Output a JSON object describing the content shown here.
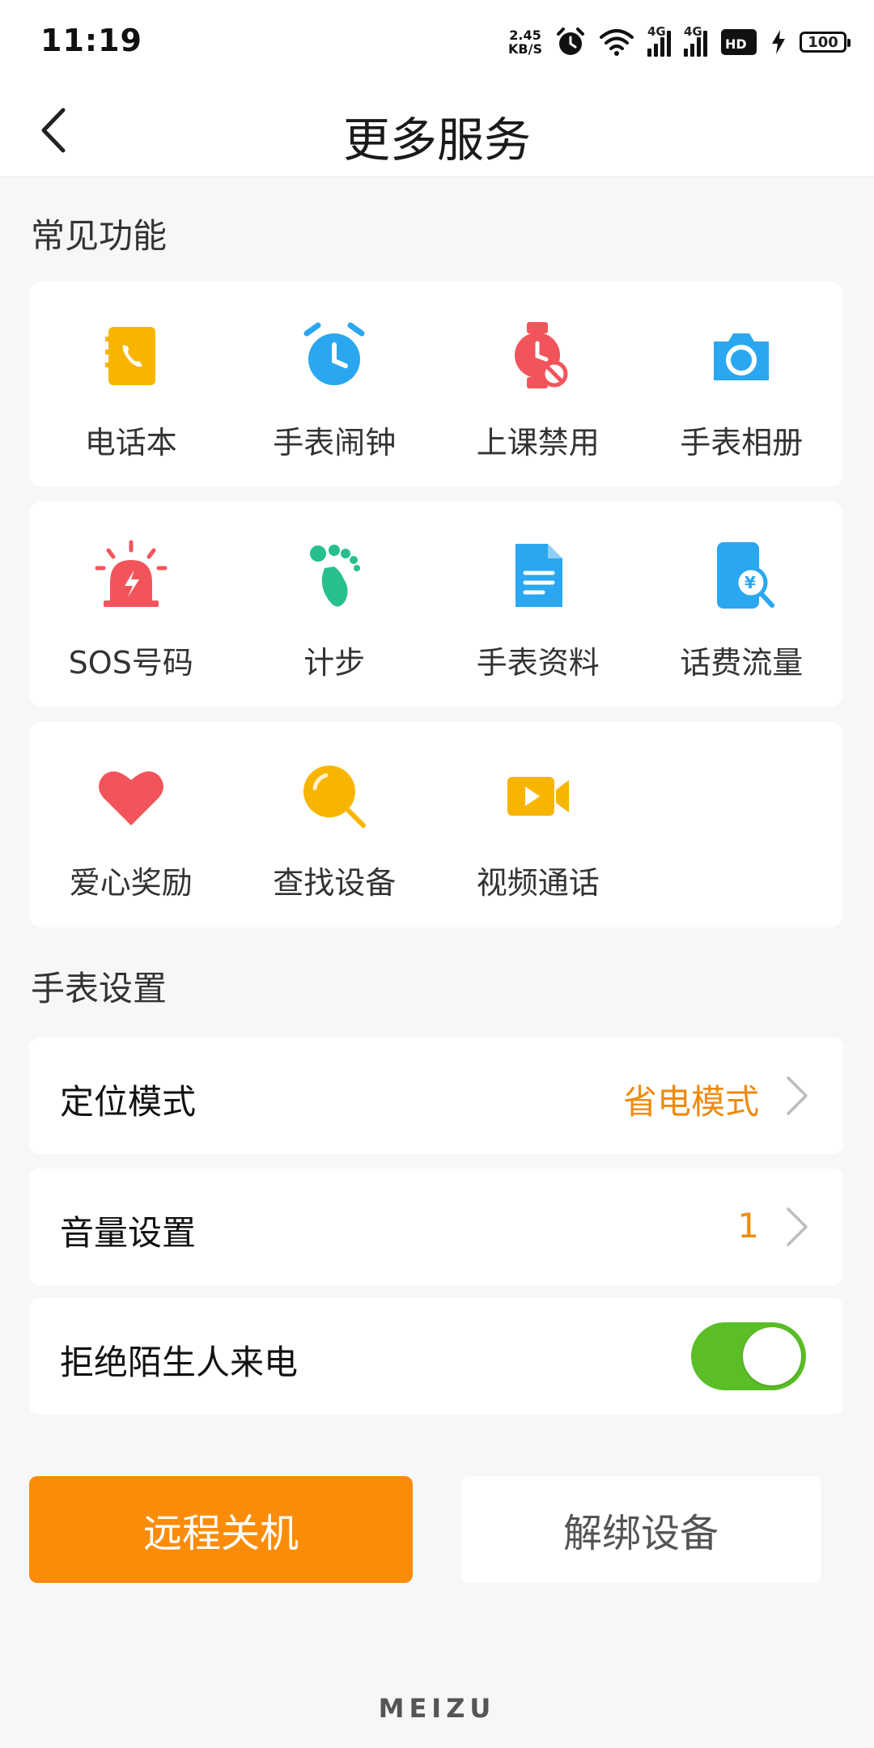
{
  "status_bar": {
    "time": "11:19",
    "net_speed_value": "2.45",
    "net_speed_unit": "KB/S",
    "network_label": "4G",
    "network_label_2": "4G",
    "battery": "100"
  },
  "header": {
    "title": "更多服务"
  },
  "sections": {
    "common_title": "常见功能",
    "settings_title": "手表设置"
  },
  "features": [
    {
      "label": "电话本",
      "icon": "phonebook-icon",
      "color": "#f7b500"
    },
    {
      "label": "手表闹钟",
      "icon": "alarm-clock-icon",
      "color": "#2aa7f0"
    },
    {
      "label": "上课禁用",
      "icon": "watch-forbidden-icon",
      "color": "#f2545b"
    },
    {
      "label": "手表相册",
      "icon": "camera-icon",
      "color": "#2aa7f0"
    },
    {
      "label": "SOS号码",
      "icon": "siren-icon",
      "color": "#f2545b"
    },
    {
      "label": "计步",
      "icon": "footprint-icon",
      "color": "#27c08a"
    },
    {
      "label": "手表资料",
      "icon": "document-icon",
      "color": "#2aa7f0"
    },
    {
      "label": "话费流量",
      "icon": "phone-bill-icon",
      "color": "#2aa7f0"
    },
    {
      "label": "爱心奖励",
      "icon": "heart-icon",
      "color": "#f2545b"
    },
    {
      "label": "查找设备",
      "icon": "magnifier-icon",
      "color": "#f7b500"
    },
    {
      "label": "视频通话",
      "icon": "video-call-icon",
      "color": "#f7b500"
    }
  ],
  "settings": {
    "location_label": "定位模式",
    "location_value": "省电模式",
    "volume_label": "音量设置",
    "volume_value": "1",
    "reject_label": "拒绝陌生人来电",
    "reject_on": true
  },
  "buttons": {
    "shutdown": "远程关机",
    "unbind": "解绑设备"
  },
  "brand": "MEIZU",
  "colors": {
    "accent": "#fb8c0a",
    "toggle_on": "#5bbe26",
    "value_text": "#f08a0c"
  }
}
